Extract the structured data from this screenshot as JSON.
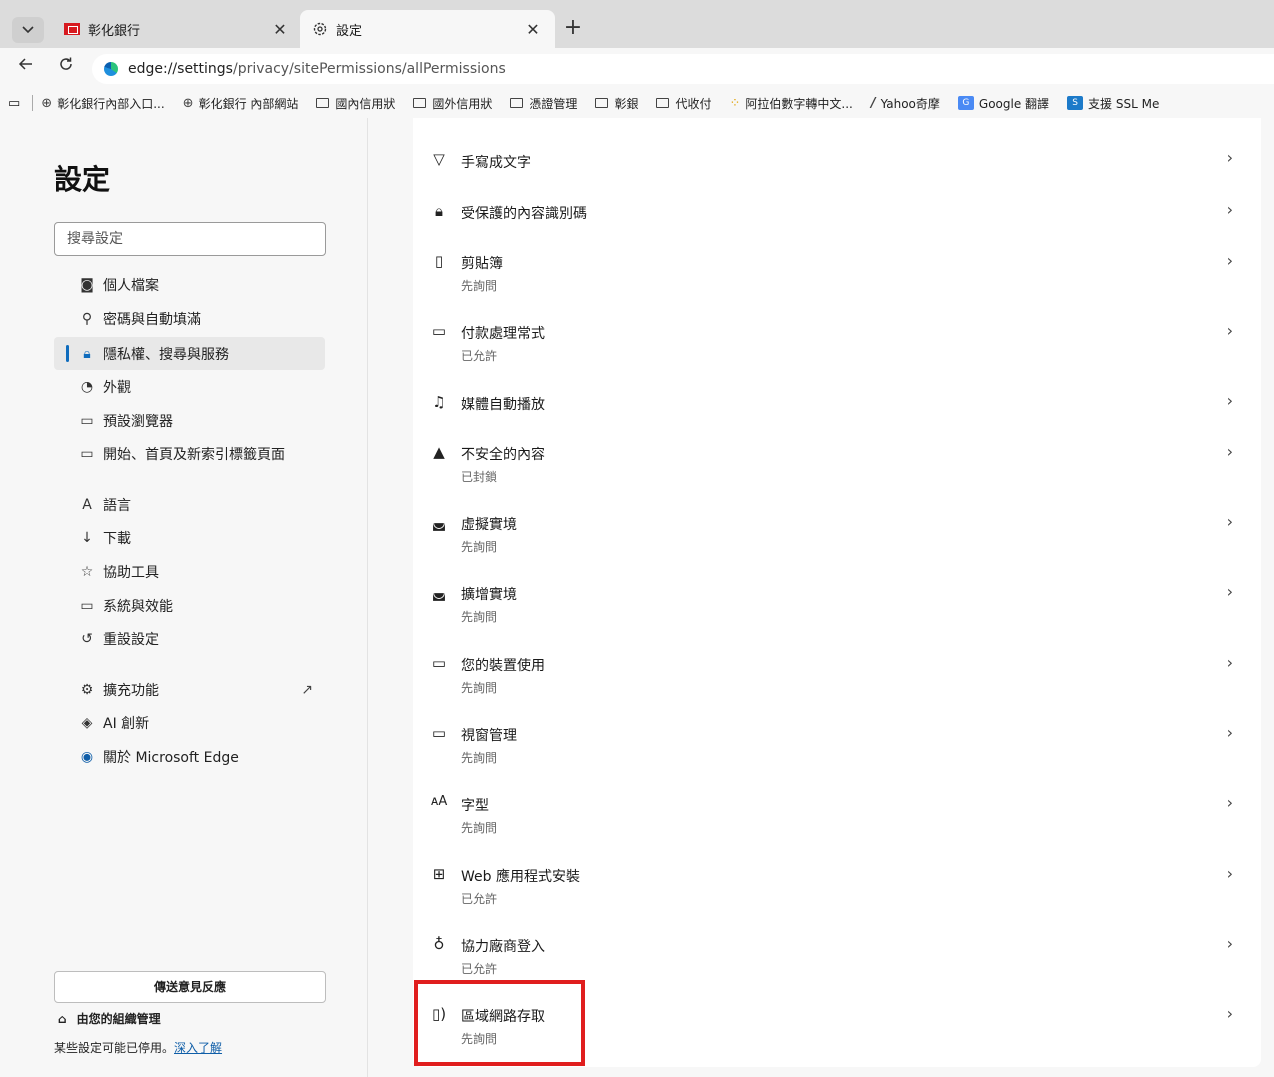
{
  "tabs": [
    {
      "title": "彰化銀行",
      "favicon": "bank-favicon",
      "close": "✕"
    },
    {
      "title": "設定",
      "favicon": "gear-icon",
      "close": "✕"
    }
  ],
  "new_tab": "+",
  "address_bar": {
    "url_scheme_host": "edge://settings",
    "url_path": "/privacy/sitePermissions/allPermissions"
  },
  "bookmarks": [
    {
      "label": "彰化銀行內部入口...",
      "icon": "globe-icon"
    },
    {
      "label": "彰化銀行 內部網站",
      "icon": "globe-icon"
    },
    {
      "label": "國內信用狀",
      "icon": "folder-icon"
    },
    {
      "label": "國外信用狀",
      "icon": "folder-icon"
    },
    {
      "label": "憑證管理",
      "icon": "folder-icon"
    },
    {
      "label": "彰銀",
      "icon": "folder-icon"
    },
    {
      "label": "代收付",
      "icon": "folder-icon"
    },
    {
      "label": "阿拉伯數字轉中文...",
      "icon": "dots-icon"
    },
    {
      "label": "Yahoo奇摩",
      "icon": "yahoo-icon"
    },
    {
      "label": "Google 翻譯",
      "icon": "google-translate-icon"
    },
    {
      "label": "支援 SSL Me",
      "icon": "ssl-icon"
    }
  ],
  "sidebar": {
    "title": "設定",
    "search_placeholder": "搜尋設定",
    "items": [
      {
        "label": "個人檔案",
        "icon": "profile-icon",
        "glyph": "◙"
      },
      {
        "label": "密碼與自動填滿",
        "icon": "key-icon",
        "glyph": "⚲"
      },
      {
        "label": "隱私權、搜尋與服務",
        "icon": "lock-icon",
        "glyph": "🔒︎",
        "active": true
      },
      {
        "label": "外觀",
        "icon": "palette-icon",
        "glyph": "◔"
      },
      {
        "label": "預設瀏覽器",
        "icon": "browser-icon",
        "glyph": "▭"
      },
      {
        "label": "開始、首頁及新索引標籤頁面",
        "icon": "home-page-icon",
        "glyph": "▭"
      },
      {
        "label": "語言",
        "icon": "language-icon",
        "glyph": "A"
      },
      {
        "label": "下載",
        "icon": "download-icon",
        "glyph": "↓"
      },
      {
        "label": "協助工具",
        "icon": "accessibility-icon",
        "glyph": "☆"
      },
      {
        "label": "系統與效能",
        "icon": "laptop-icon",
        "glyph": "▭"
      },
      {
        "label": "重設設定",
        "icon": "reset-icon",
        "glyph": "↺"
      },
      {
        "label": "擴充功能",
        "icon": "extensions-icon",
        "glyph": "⚙"
      },
      {
        "label": "AI 創新",
        "icon": "ai-icon",
        "glyph": "◈"
      },
      {
        "label": "關於 Microsoft Edge",
        "icon": "edge-icon",
        "glyph": "◉"
      }
    ],
    "external_link_glyph": "↗",
    "feedback_button": "傳送意見反應",
    "org_managed": "由您的組織管理",
    "org_note": "某些設定可能已停用。",
    "org_link": "深入了解"
  },
  "permissions": [
    {
      "label": "手寫成文字",
      "status": "",
      "icon": "handwriting-icon",
      "glyph": "▽"
    },
    {
      "label": "受保護的內容識別碼",
      "status": "",
      "icon": "protected-lock-icon",
      "glyph": "🔒︎"
    },
    {
      "label": "剪貼簿",
      "status": "先詢問",
      "icon": "clipboard-icon",
      "glyph": "▯"
    },
    {
      "label": "付款處理常式",
      "status": "已允許",
      "icon": "card-icon",
      "glyph": "▭"
    },
    {
      "label": "媒體自動播放",
      "status": "",
      "icon": "music-icon",
      "glyph": "♫"
    },
    {
      "label": "不安全的內容",
      "status": "已封鎖",
      "icon": "warning-icon",
      "glyph": "▲"
    },
    {
      "label": "虛擬實境",
      "status": "先詢問",
      "icon": "vr-icon",
      "glyph": "◛"
    },
    {
      "label": "擴增實境",
      "status": "先詢問",
      "icon": "ar-icon",
      "glyph": "◛"
    },
    {
      "label": "您的裝置使用",
      "status": "先詢問",
      "icon": "laptop-icon",
      "glyph": "▭"
    },
    {
      "label": "視窗管理",
      "status": "先詢問",
      "icon": "window-icon",
      "glyph": "▭"
    },
    {
      "label": "字型",
      "status": "先詢問",
      "icon": "font-icon",
      "glyph": "ᴀA"
    },
    {
      "label": "Web 應用程式安裝",
      "status": "已允許",
      "icon": "app-install-icon",
      "glyph": "⊞"
    },
    {
      "label": "協力廠商登入",
      "status": "已允許",
      "icon": "person-icon",
      "glyph": "♁"
    },
    {
      "label": "區域網路存取",
      "status": "先詢問",
      "icon": "network-device-icon",
      "glyph": "▯)"
    }
  ],
  "chevron": "›",
  "colors": {
    "accent": "#0f6cbd",
    "highlight": "#e01e1e",
    "tabstrip": "#dcdcdc"
  }
}
